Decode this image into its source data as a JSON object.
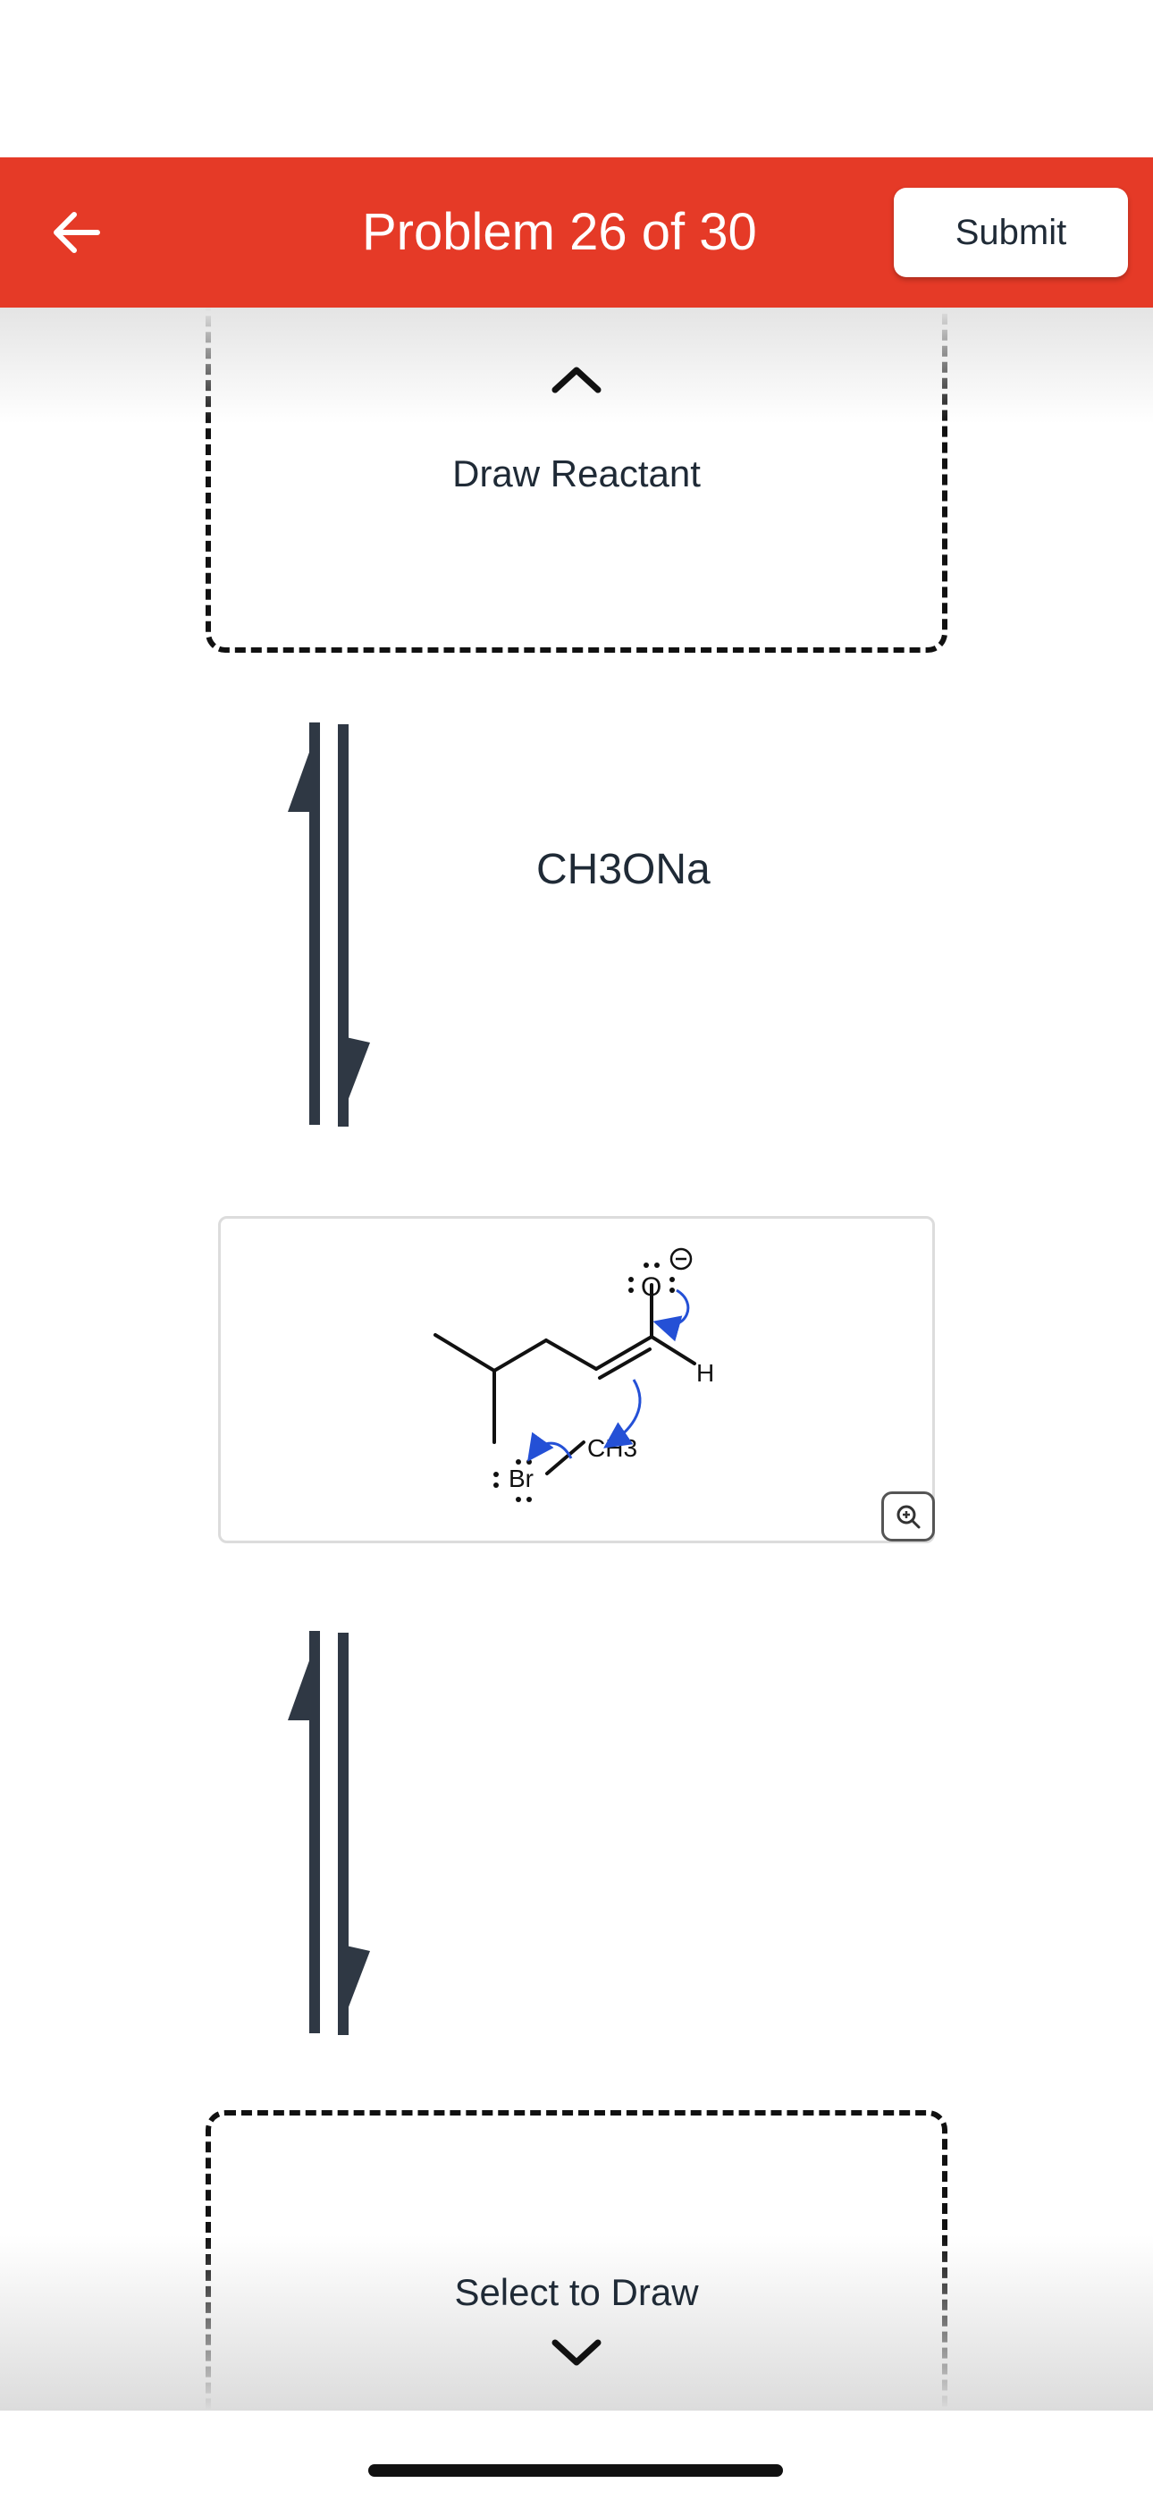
{
  "header": {
    "title": "Problem 26 of 30",
    "submit_label": "Submit",
    "bg_color": "#e53a27"
  },
  "icons": {
    "back": "arrow-left-icon",
    "collapse": "chevron-up-icon",
    "expand": "chevron-down-icon",
    "equilibrium": "equilibrium-arrows-icon",
    "zoom": "zoom-in-icon"
  },
  "reactant_box": {
    "label": "Draw Reactant"
  },
  "reagent": "CH3ONa",
  "structure": {
    "oxygen": "O",
    "hydrogen": "H",
    "methyl": "CH3",
    "bromine": "Br",
    "arrow_color": "#2450d6"
  },
  "product_box": {
    "label": "Select to Draw"
  }
}
